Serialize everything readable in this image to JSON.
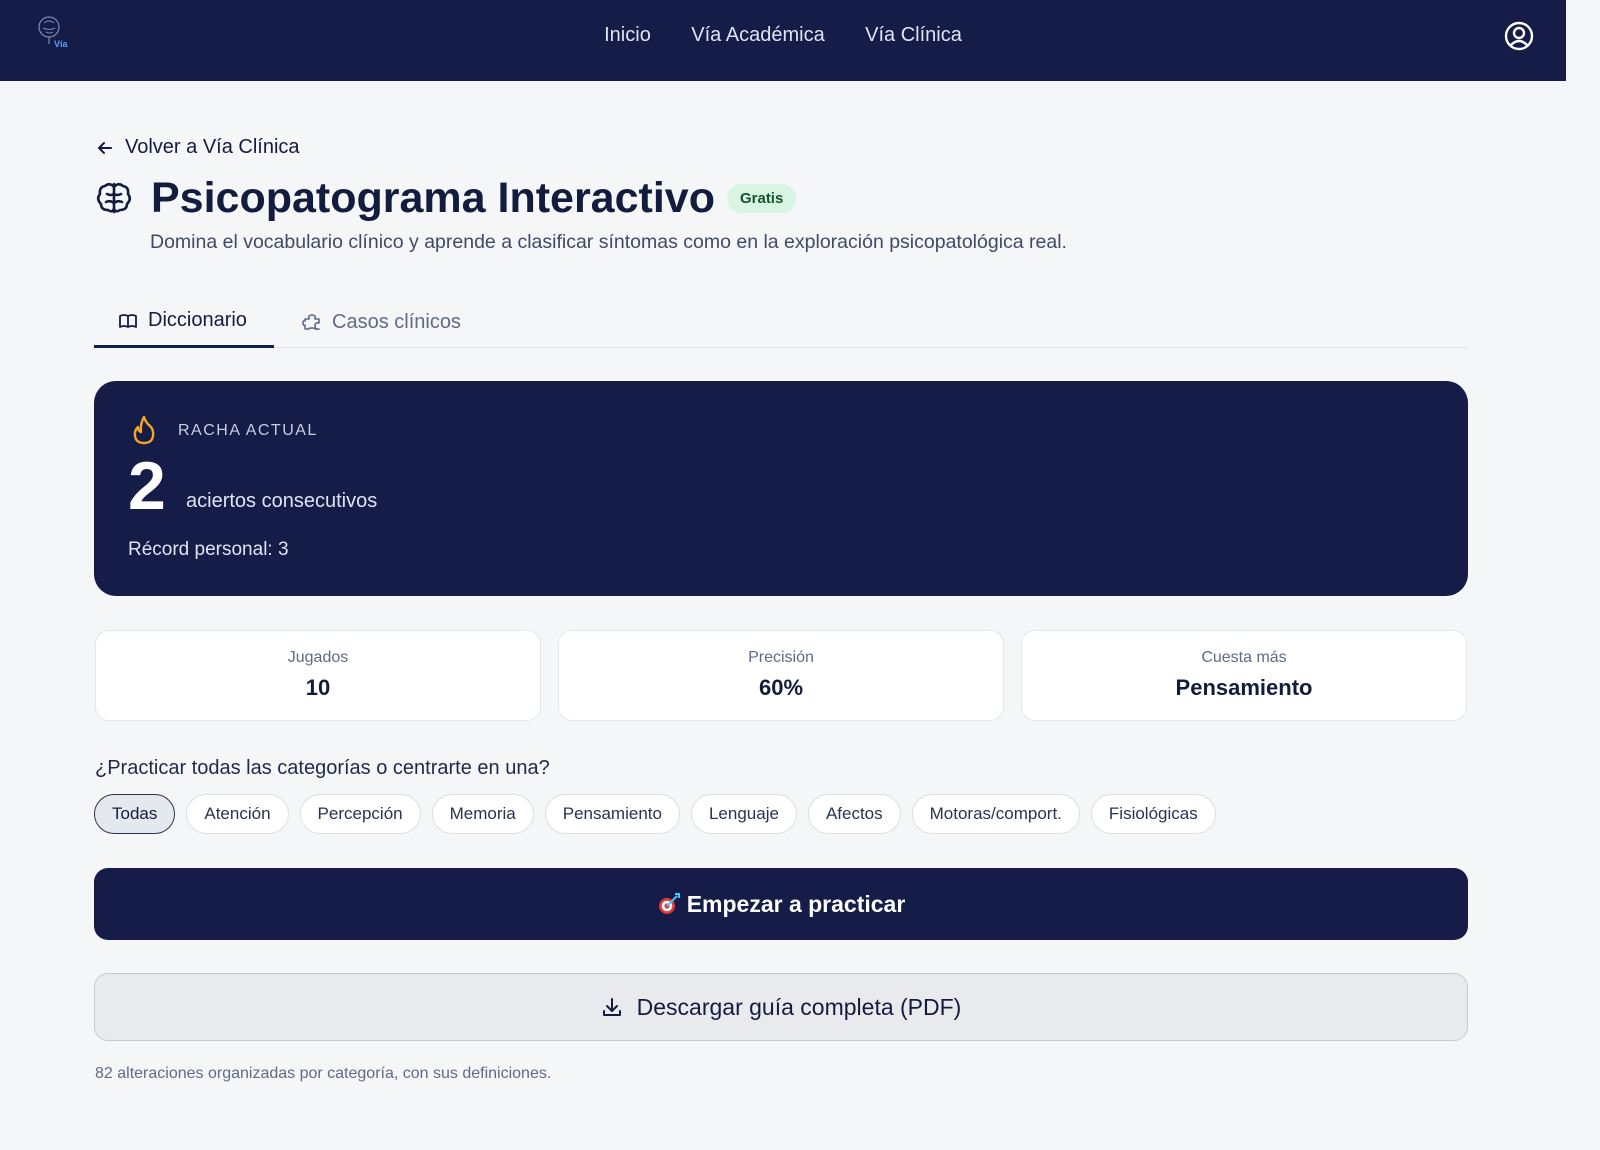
{
  "nav": {
    "logo_text": "Vía",
    "items": [
      "Inicio",
      "Vía Académica",
      "Vía Clínica"
    ],
    "user_icon": "user-circle-icon"
  },
  "back_link": "Volver a Vía Clínica",
  "header": {
    "title": "Psicopatograma Interactivo",
    "badge": "Gratis",
    "subtitle": "Domina el vocabulario clínico y aprende a clasificar síntomas como en la exploración psicopatológica real."
  },
  "tabs": [
    {
      "label": "Diccionario",
      "icon": "book-open-icon",
      "active": true
    },
    {
      "label": "Casos clínicos",
      "icon": "puzzle-icon",
      "active": false
    }
  ],
  "streak": {
    "label": "RACHA ACTUAL",
    "value": "2",
    "unit": "aciertos consecutivos",
    "record": "Récord personal: 3"
  },
  "stats": [
    {
      "label": "Jugados",
      "value": "10"
    },
    {
      "label": "Precisión",
      "value": "60%"
    },
    {
      "label": "Cuesta más",
      "value": "Pensamiento"
    }
  ],
  "categories": {
    "question": "¿Practicar todas las categorías o centrarte en una?",
    "items": [
      "Todas",
      "Atención",
      "Percepción",
      "Memoria",
      "Pensamiento",
      "Lenguaje",
      "Afectos",
      "Motoras/comport.",
      "Fisiológicas"
    ],
    "selected": "Todas"
  },
  "start_button": "Empezar a practicar",
  "download_button": "Descargar guía completa (PDF)",
  "footnote": "82 alteraciones organizadas por categoría, con sus definiciones.",
  "colors": {
    "navy": "#141c47",
    "badge_bg": "#d8f5e3",
    "flame": "#f5a623"
  }
}
